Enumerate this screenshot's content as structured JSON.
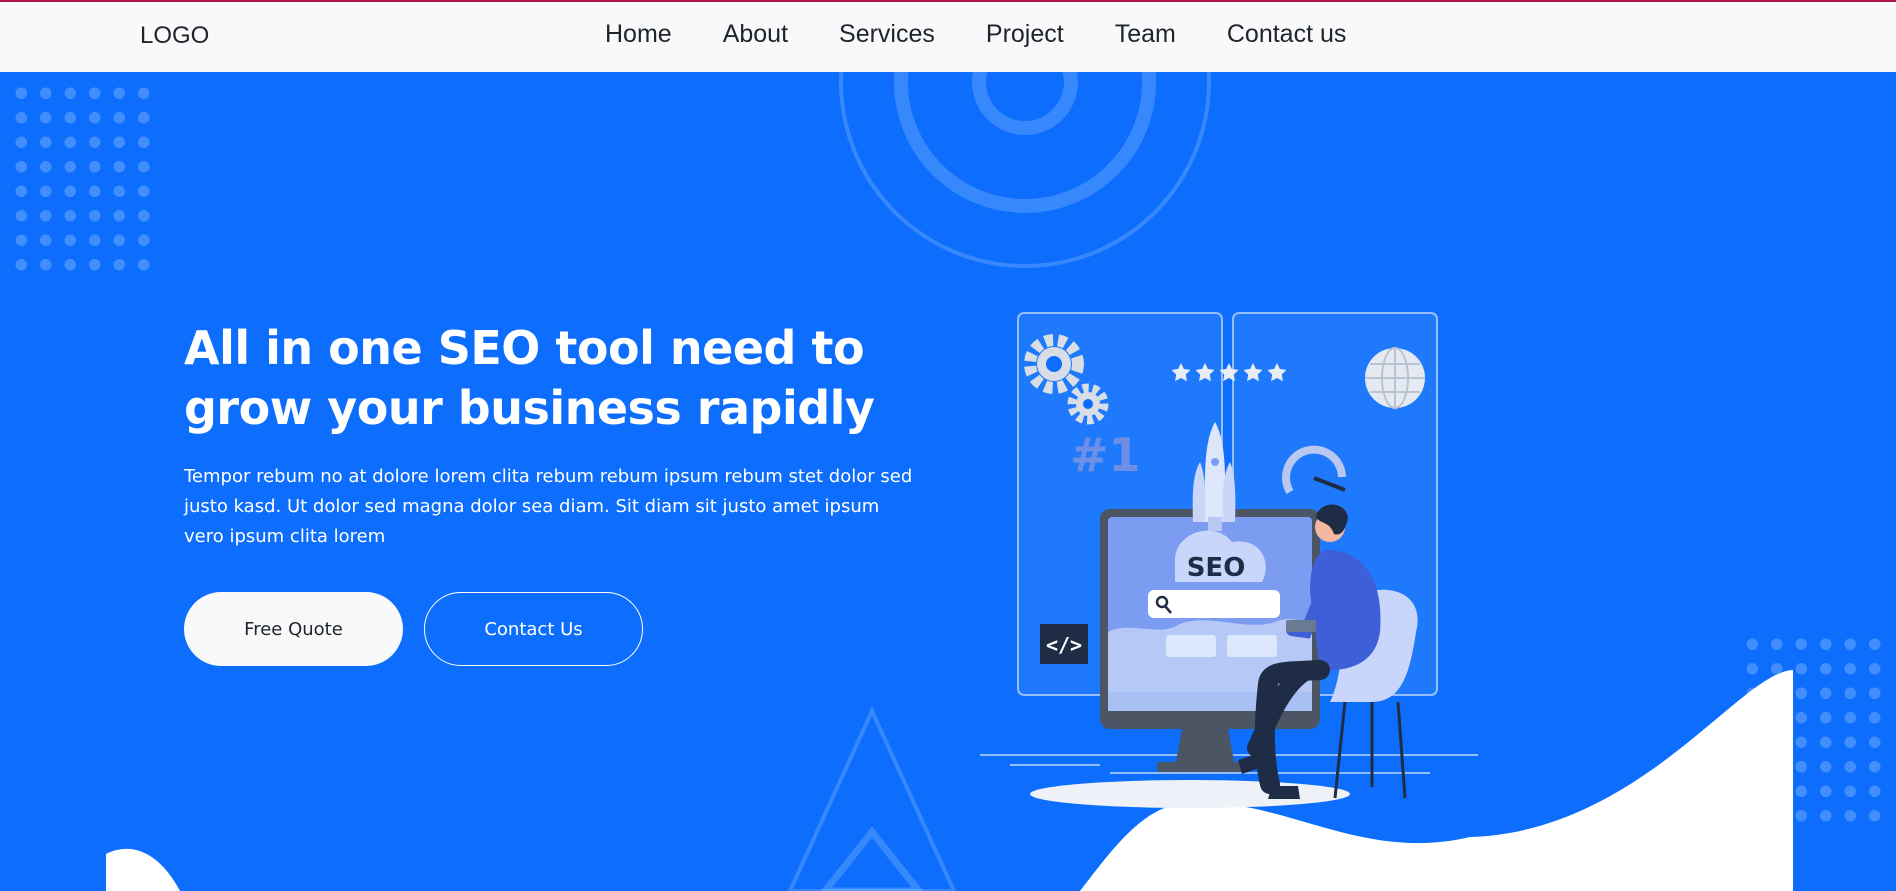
{
  "header": {
    "logo": "LOGO",
    "nav": [
      {
        "label": "Home"
      },
      {
        "label": "About"
      },
      {
        "label": "Services"
      },
      {
        "label": "Project"
      },
      {
        "label": "Team"
      },
      {
        "label": "Contact us"
      }
    ]
  },
  "hero": {
    "title_line1": "All in one SEO tool need to",
    "title_line2": "grow your business rapidly",
    "description": "Tempor rebum no at dolore lorem clita rebum rebum ipsum rebum stet dolor sed justo kasd. Ut dolor sed magna dolor sea diam. Sit diam sit justo amet ipsum vero ipsum clita lorem",
    "primary_button": "Free Quote",
    "secondary_button": "Contact Us"
  },
  "illustration": {
    "seo_label": "SEO",
    "rank_label": "#1",
    "code_label": "</>",
    "stars": 5
  },
  "colors": {
    "primary": "#0d6efd",
    "header_bg": "#f8f9fa",
    "top_accent": "#b0174e",
    "text_dark": "#212529",
    "white": "#ffffff"
  }
}
